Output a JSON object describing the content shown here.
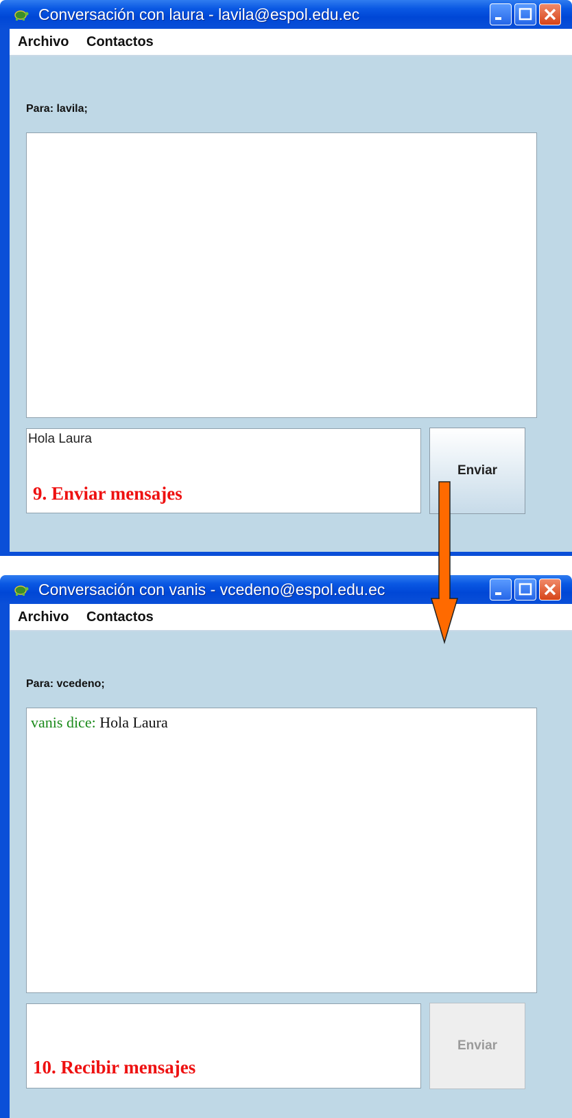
{
  "windows": [
    {
      "title": "Conversación con laura - lavila@espol.edu.ec",
      "menu": [
        "Archivo",
        "Contactos"
      ],
      "para_label": "Para:  lavila;",
      "conversation": {
        "author": "",
        "text": ""
      },
      "input_value": "Hola Laura",
      "send_label": "Enviar",
      "send_enabled": true,
      "caption": "9. Enviar mensajes"
    },
    {
      "title": "Conversación con vanis - vcedeno@espol.edu.ec",
      "menu": [
        "Archivo",
        "Contactos"
      ],
      "para_label": "Para:  vcedeno;",
      "conversation": {
        "author": "vanis dice:",
        "text": " Hola Laura"
      },
      "input_value": "",
      "send_label": "Enviar",
      "send_enabled": false,
      "caption": "10. Recibir mensajes"
    }
  ],
  "colors": {
    "titlebar": "#0a58e3",
    "client_background": "#bfd8e6",
    "caption": "#ee1111",
    "author": "#1a8a1a",
    "arrow": "#ff6a00"
  },
  "icons": [
    "turtle-icon",
    "minimize-icon",
    "maximize-icon",
    "close-icon",
    "down-arrow-icon"
  ]
}
